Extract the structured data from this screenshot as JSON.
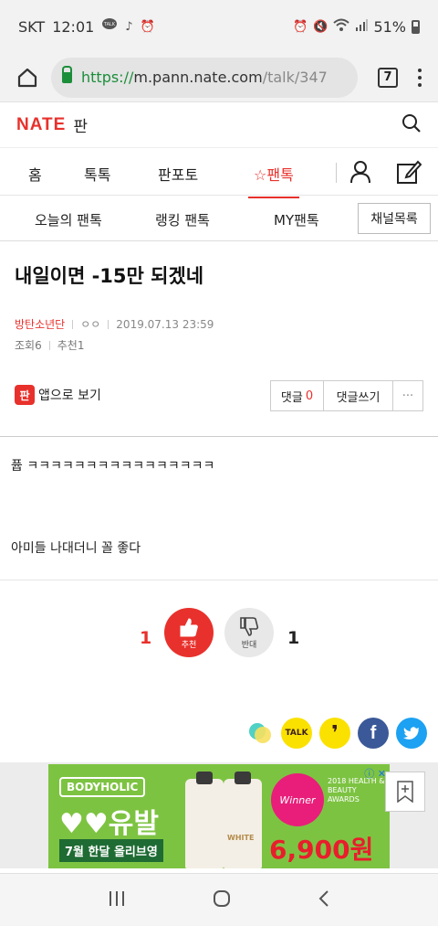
{
  "status_bar": {
    "carrier": "SKT",
    "time": "12:01",
    "talk_badge": "TALK",
    "battery": "51%"
  },
  "browser": {
    "url_scheme": "https://",
    "url_host": "m.pann.nate.com",
    "url_path": "/talk/347",
    "tab_count": "7"
  },
  "site": {
    "logo": "NATE",
    "logo_sub": "판"
  },
  "main_nav": {
    "items": [
      "홈",
      "톡톡",
      "판포토",
      "팬톡"
    ],
    "active": "팬톡"
  },
  "sub_nav": {
    "items": [
      "오늘의 팬톡",
      "랭킹 팬톡",
      "MY팬톡"
    ],
    "channel_button": "채널목록"
  },
  "post": {
    "title": "내일이면 -15만 되겠네",
    "author": "방탄소년단",
    "handle": "ㅇㅇ",
    "datetime": "2019.07.13 23:59",
    "views_label": "조회",
    "views": "6",
    "recommend_label": "추천",
    "recommend": "1",
    "body_line1": "퓹 ㅋㅋㅋㅋㅋㅋㅋㅋㅋㅋㅋㅋㅋㅋㅋㅋ",
    "body_line2": "아미들 나대더니 꼴 좋다"
  },
  "actions": {
    "app_icon": "판",
    "app_link": "앱으로 보기",
    "comment_label": "댓글",
    "comment_count": "0",
    "write_comment": "댓글쓰기",
    "more": "···"
  },
  "votes": {
    "up_count": "1",
    "up_label": "추천",
    "down_count": "1",
    "down_label": "반대"
  },
  "share": {
    "kakaotalk": "TALK"
  },
  "ad": {
    "brand": "BODYHOLIC",
    "title": "♥♥유발",
    "subtitle": "7월 한달 올리브영",
    "badge": "Winner",
    "award": "2018 HEALTH & BEAUTY AWARDS",
    "price": "6,900원",
    "bottle_label": "WHITE"
  },
  "colors": {
    "accent": "#e8312c",
    "ad_green": "#7dc342",
    "facebook": "#3b5998",
    "twitter": "#1da1f2",
    "kakao_yellow": "#fae100"
  }
}
